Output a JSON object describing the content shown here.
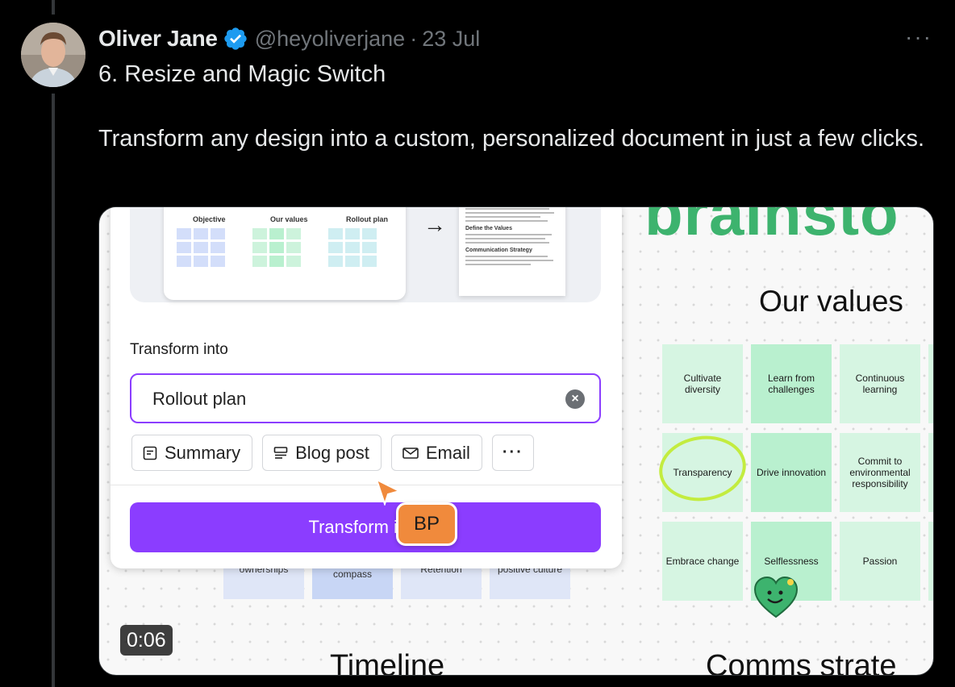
{
  "tweet": {
    "author_name": "Oliver Jane",
    "handle": "@heyoliverjane",
    "separator": "·",
    "date": "23 Jul",
    "more_label": "···",
    "text_line1": "6. Resize and Magic Switch",
    "text_line2": "Transform any design into a custom, personalized document in just a few clicks."
  },
  "video": {
    "timestamp": "0:06",
    "preview": {
      "board_title": "brainstorm",
      "columns": [
        "Objective",
        "Our values",
        "Rollout plan"
      ],
      "doc_headings": [
        "Define the Values",
        "Communication Strategy"
      ]
    },
    "panel": {
      "label": "Transform into",
      "input_value": "Rollout plan",
      "clear_icon": "×",
      "chips": [
        "Summary",
        "Blog post",
        "Email"
      ],
      "more_chip": "···",
      "transform_button": "Transform into",
      "cursor_badge": "BP"
    },
    "bottom_cards": [
      "ownerships",
      "compass",
      "Retention",
      "positive culture"
    ],
    "canvas": {
      "big_title": "brainsto",
      "values_heading": "Our values",
      "values": [
        "Cultivate diversity",
        "Learn from challenges",
        "Continuous learning",
        "Transparency",
        "Drive innovation",
        "Commit to environmental responsibility",
        "Embrace change",
        "Selflessness",
        "Passion"
      ],
      "timeline_heading": "Timeline",
      "comms_heading": "Comms strate"
    }
  },
  "colors": {
    "accent_purple": "#8b3dff",
    "brand_green": "#3db36e",
    "verified_blue": "#1d9bf0",
    "badge_orange": "#f08a3c"
  }
}
